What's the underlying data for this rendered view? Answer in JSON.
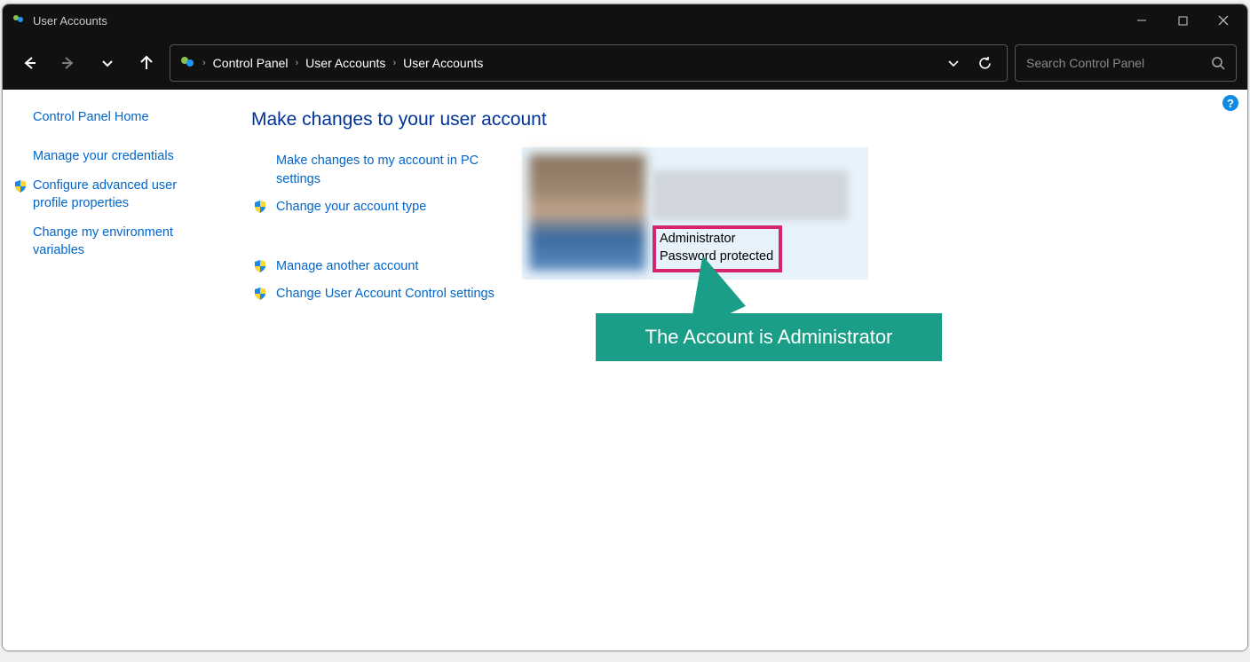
{
  "window": {
    "title": "User Accounts"
  },
  "winctl": {
    "min": "—",
    "max": "☐",
    "close": "✕"
  },
  "breadcrumbs": {
    "b0": "Control Panel",
    "b1": "User Accounts",
    "b2": "User Accounts"
  },
  "search": {
    "placeholder": "Search Control Panel"
  },
  "sidebar": {
    "home": "Control Panel Home",
    "s0": "Manage your credentials",
    "s1": "Configure advanced user profile properties",
    "s2": "Change my environment variables"
  },
  "main": {
    "heading": "Make changes to your user account",
    "a0": "Make changes to my account in PC settings",
    "a1": "Change your account type",
    "a2": "Manage another account",
    "a3": "Change User Account Control settings"
  },
  "account": {
    "role": "Administrator",
    "status": "Password protected"
  },
  "callout": {
    "text": "The Account is Administrator"
  }
}
